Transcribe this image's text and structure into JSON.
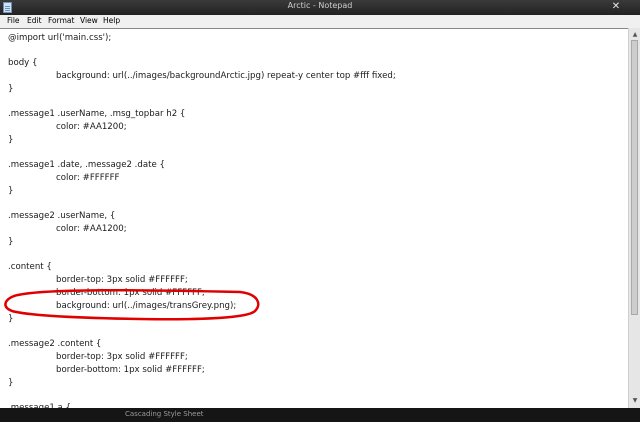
{
  "window": {
    "title": "Arctic - Notepad",
    "close_symbol": "✕"
  },
  "menu": [
    "File",
    "Edit",
    "Format",
    "View",
    "Help"
  ],
  "editor": {
    "lines": [
      "@import url('main.css');",
      "",
      "body {",
      "background: url(../images/backgroundArctic.jpg) repeat-y center top #fff fixed;",
      "}",
      "",
      ".message1 .userName, .msg_topbar h2 {",
      "color: #AA1200;",
      "}",
      "",
      ".message1 .date, .message2 .date {",
      "color: #FFFFFF",
      "}",
      "",
      ".message2 .userName, {",
      "color: #AA1200;",
      "}",
      "",
      ".content {",
      "border-top: 3px solid #FFFFFF;",
      "border-bottom: 1px solid #FFFFFF;",
      "background: url(../images/transGrey.png);",
      "}",
      "",
      ".message2 .content {",
      "border-top: 3px solid #FFFFFF;",
      "border-bottom: 1px solid #FFFFFF;",
      "}",
      "",
      ".message1 a {"
    ],
    "highlight_color": "#e00000"
  },
  "taskbar": {
    "item": "Cascading Style Sheet"
  },
  "scrollbar": {
    "up_symbol": "▲",
    "down_symbol": "▼"
  }
}
